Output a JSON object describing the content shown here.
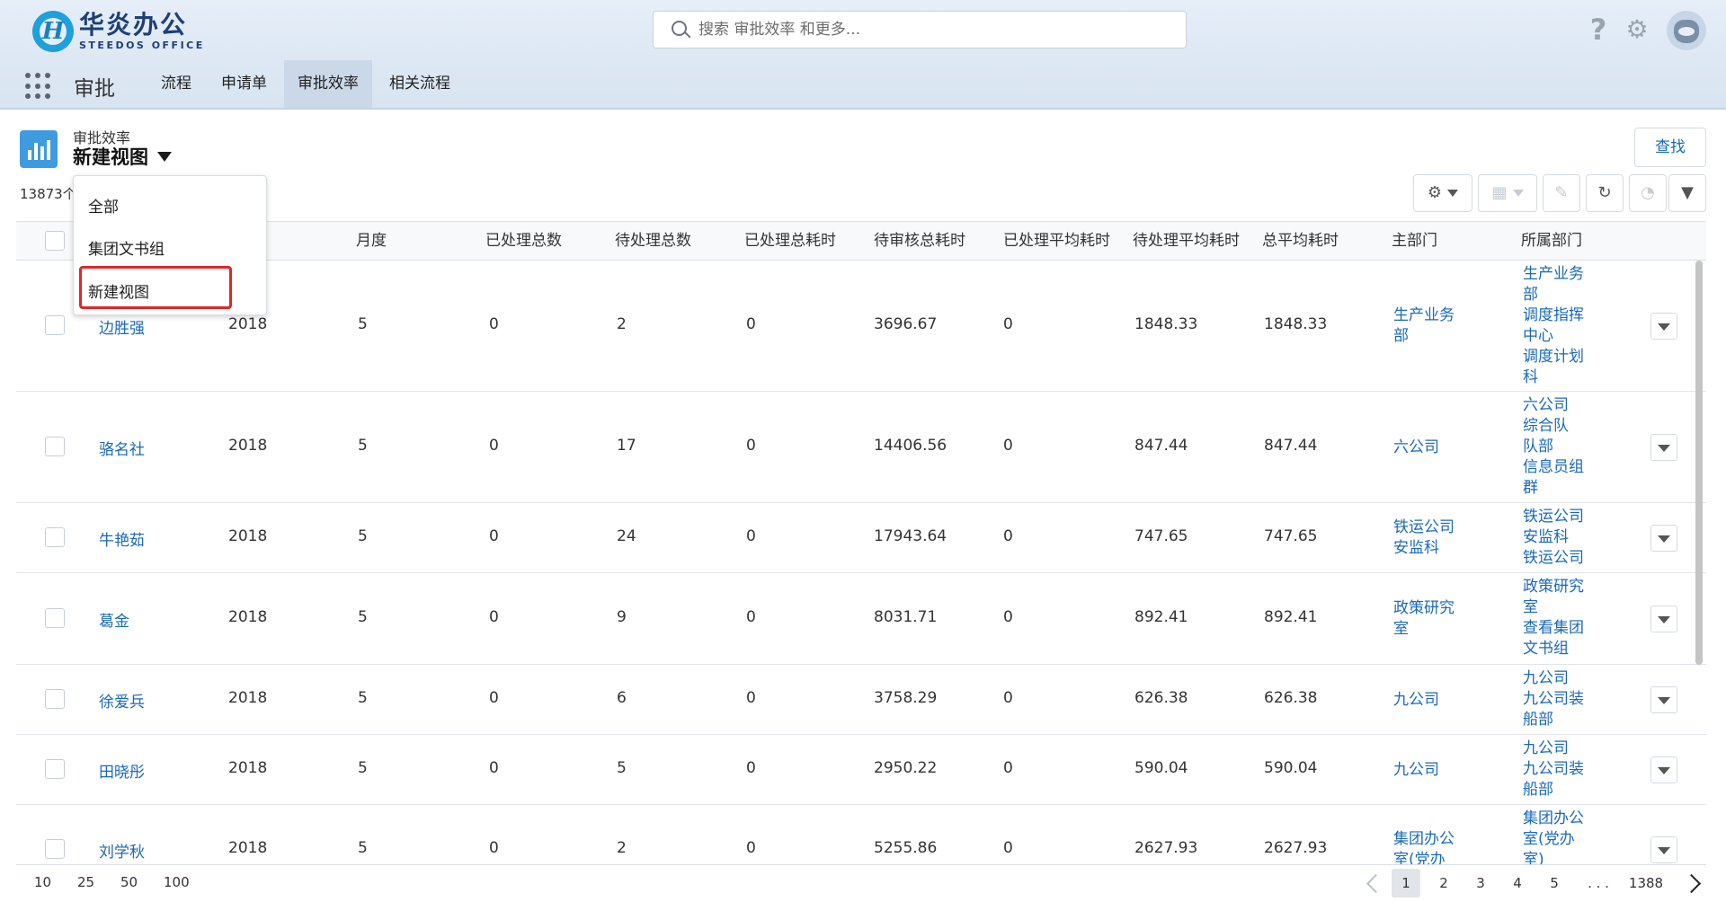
{
  "header": {
    "logo_cn": "华炎办公",
    "logo_en": "STEEDOS OFFICE",
    "search_placeholder": "搜索 审批效率 和更多...",
    "help_glyph": "?",
    "gear_glyph": "⚙"
  },
  "nav": {
    "app_name": "审批",
    "tabs": [
      "流程",
      "申请单",
      "审批效率",
      "相关流程"
    ],
    "active_tab": "审批效率"
  },
  "page": {
    "object_label": "审批效率",
    "view_name": "新建视图",
    "record_count": "13873个",
    "find_label": "查找"
  },
  "view_menu": {
    "items": [
      "全部",
      "集团文书组",
      "新建视图"
    ],
    "highlighted": "新建视图"
  },
  "table": {
    "columns": [
      "月度",
      "已处理总数",
      "待处理总数",
      "已处理总耗时",
      "待审核总耗时",
      "已处理平均耗时",
      "待处理平均耗时",
      "总平均耗时",
      "主部门",
      "所属部门"
    ],
    "rows": [
      {
        "name": "边胜强",
        "year": "2018",
        "month": "5",
        "done": "0",
        "pending": "2",
        "done_time": "0",
        "pending_time": "3696.67",
        "done_avg": "0",
        "pending_avg": "1848.33",
        "total_avg": "1848.33",
        "main_dept": "生产业务部",
        "depts": "生产业务部\n调度指挥中心\n调度计划科"
      },
      {
        "name": "骆名社",
        "year": "2018",
        "month": "5",
        "done": "0",
        "pending": "17",
        "done_time": "0",
        "pending_time": "14406.56",
        "done_avg": "0",
        "pending_avg": "847.44",
        "total_avg": "847.44",
        "main_dept": "六公司",
        "depts": "六公司\n综合队\n队部\n信息员组群"
      },
      {
        "name": "牛艳茹",
        "year": "2018",
        "month": "5",
        "done": "0",
        "pending": "24",
        "done_time": "0",
        "pending_time": "17943.64",
        "done_avg": "0",
        "pending_avg": "747.65",
        "total_avg": "747.65",
        "main_dept": "铁运公司安监科",
        "depts": "铁运公司\n安监科\n铁运公司"
      },
      {
        "name": "葛金",
        "year": "2018",
        "month": "5",
        "done": "0",
        "pending": "9",
        "done_time": "0",
        "pending_time": "8031.71",
        "done_avg": "0",
        "pending_avg": "892.41",
        "total_avg": "892.41",
        "main_dept": "政策研究室",
        "depts": "政策研究室\n查看集团文书组"
      },
      {
        "name": "徐爱兵",
        "year": "2018",
        "month": "5",
        "done": "0",
        "pending": "6",
        "done_time": "0",
        "pending_time": "3758.29",
        "done_avg": "0",
        "pending_avg": "626.38",
        "total_avg": "626.38",
        "main_dept": "九公司",
        "depts": "九公司\n九公司装船部"
      },
      {
        "name": "田晓彤",
        "year": "2018",
        "month": "5",
        "done": "0",
        "pending": "5",
        "done_time": "0",
        "pending_time": "2950.22",
        "done_avg": "0",
        "pending_avg": "590.04",
        "total_avg": "590.04",
        "main_dept": "九公司",
        "depts": "九公司\n九公司装船部"
      },
      {
        "name": "刘学秋",
        "year": "2018",
        "month": "5",
        "done": "0",
        "pending": "2",
        "done_time": "0",
        "pending_time": "5255.86",
        "done_avg": "0",
        "pending_avg": "2627.93",
        "total_avg": "2627.93",
        "main_dept": "集团办公室(党办",
        "depts": "集团办公\n室(党办\n室)"
      }
    ]
  },
  "pagination": {
    "page_sizes": [
      "10",
      "25",
      "50",
      "100"
    ],
    "pages": [
      "1",
      "2",
      "3",
      "4",
      "5",
      ". . .",
      "1388"
    ],
    "current_page": "1"
  },
  "colors": {
    "link": "#1a69b6",
    "accent": "#3f9be0",
    "highlight_box": "#e0262a"
  }
}
